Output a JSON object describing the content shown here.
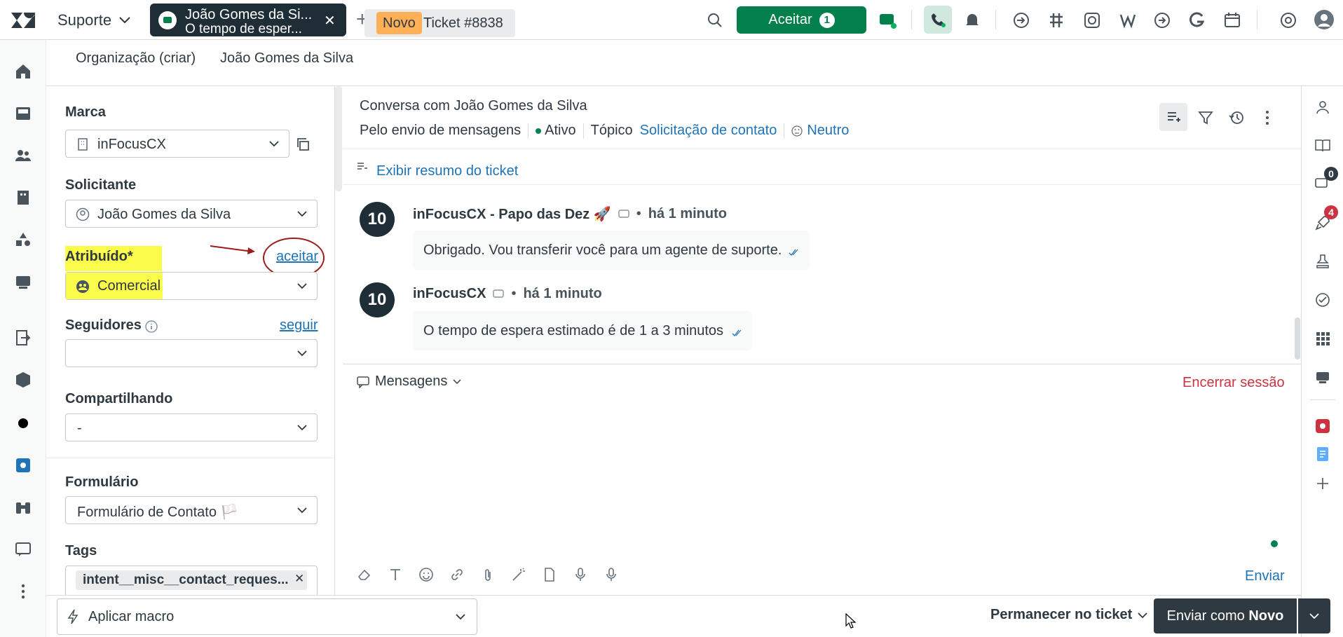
{
  "topbar": {
    "product": "Suporte",
    "ticket_tab": {
      "name": "João Gomes da Si...",
      "preview": "O tempo de esper..."
    },
    "accept_label": "Aceitar",
    "accept_count": "1"
  },
  "subtabs": {
    "organization": "Organização (criar)",
    "requester": "João Gomes da Silva",
    "status_badge": "Novo",
    "ticket_number": "Ticket #8838"
  },
  "fields": {
    "brand_label": "Marca",
    "brand_value": "inFocusCX",
    "requester_label": "Solicitante",
    "requester_value": "João Gomes da Silva",
    "assigned_label": "Atribuído*",
    "assigned_value": "Comercial",
    "accept_link": "aceitar",
    "followers_label": "Seguidores",
    "follow_link": "seguir",
    "sharing_label": "Compartilhando",
    "sharing_value": "-",
    "form_label": "Formulário",
    "form_value": "Formulário de Contato 🏳️",
    "tags_label": "Tags",
    "tag_1": "intent__misc__contact_reques..."
  },
  "conversation": {
    "title": "Conversa com João Gomes da Silva",
    "channel": "Pelo envio de mensagens",
    "status": "Ativo",
    "topic_label": "Tópico",
    "topic_value": "Solicitação de contato",
    "sentiment": "Neutro",
    "summary_link": "Exibir resumo do ticket",
    "messages": [
      {
        "author": "inFocusCX - Papo das Dez 🚀",
        "time": "há 1 minuto",
        "text": "Obrigado. Vou transferir você para um agente de suporte.",
        "avatar": "10"
      },
      {
        "author": "inFocusCX",
        "time": "há 1 minuto",
        "text": "O tempo de espera estimado é de 1 a 3 minutos",
        "avatar": "10"
      }
    ]
  },
  "composer": {
    "channel_label": "Mensagens",
    "end_session": "Encerrar sessão",
    "send": "Enviar"
  },
  "rightrail": {
    "badge_chat": "0",
    "badge_notes": "4"
  },
  "bottom": {
    "macro_label": "Aplicar macro",
    "stay_label": "Permanecer no ticket",
    "submit_prefix": "Enviar como ",
    "submit_status": "Novo"
  },
  "colors": {
    "accent_green": "#037f4c",
    "link_blue": "#1f73b7",
    "highlight": "#fbfb4b",
    "danger": "#cc3340",
    "novo_badge": "#ffb057"
  }
}
